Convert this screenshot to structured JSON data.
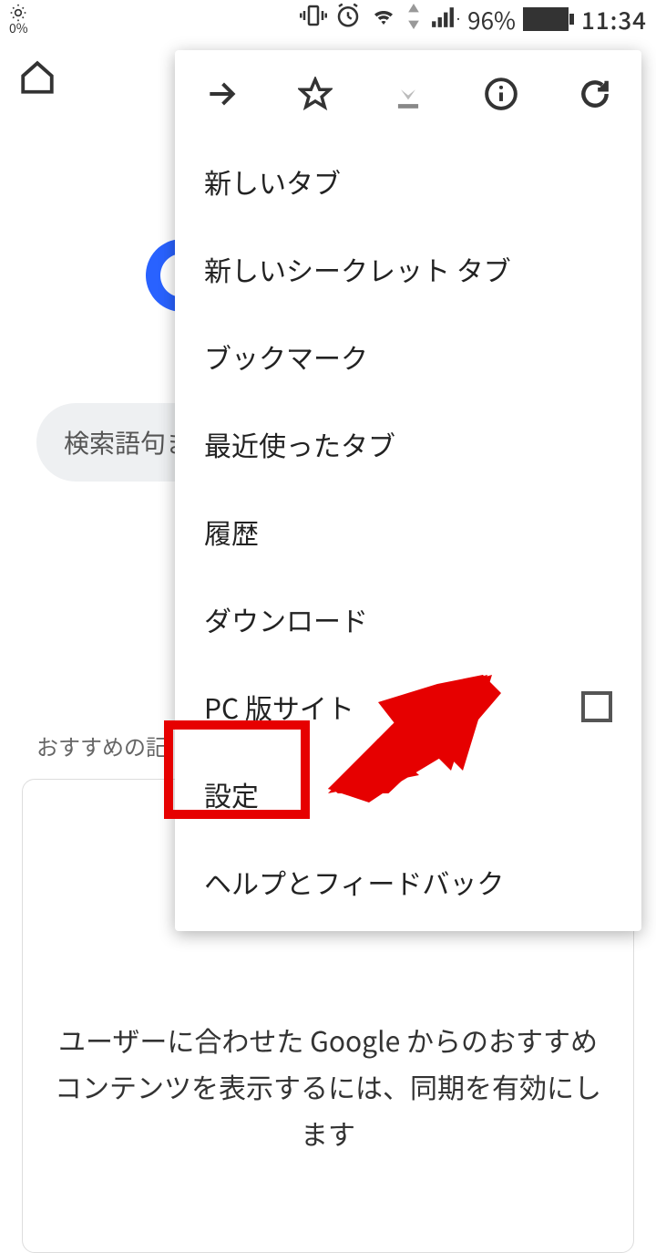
{
  "status": {
    "brightness_pct": "0%",
    "battery_pct": "96%",
    "time": "11:34"
  },
  "background": {
    "search_placeholder": "検索語句ま",
    "recommend_label": "おすすめの記",
    "card_text": "ユーザーに合わせた Google からのおすすめコンテンツを表示するには、同期を有効にします"
  },
  "menu": {
    "items": [
      {
        "label": "新しいタブ"
      },
      {
        "label": "新しいシークレット タブ"
      },
      {
        "label": "ブックマーク"
      },
      {
        "label": "最近使ったタブ"
      },
      {
        "label": "履歴"
      },
      {
        "label": "ダウンロード"
      },
      {
        "label": "PC 版サイト",
        "checkbox": true
      },
      {
        "label": "設定"
      },
      {
        "label": "ヘルプとフィードバック"
      }
    ]
  }
}
